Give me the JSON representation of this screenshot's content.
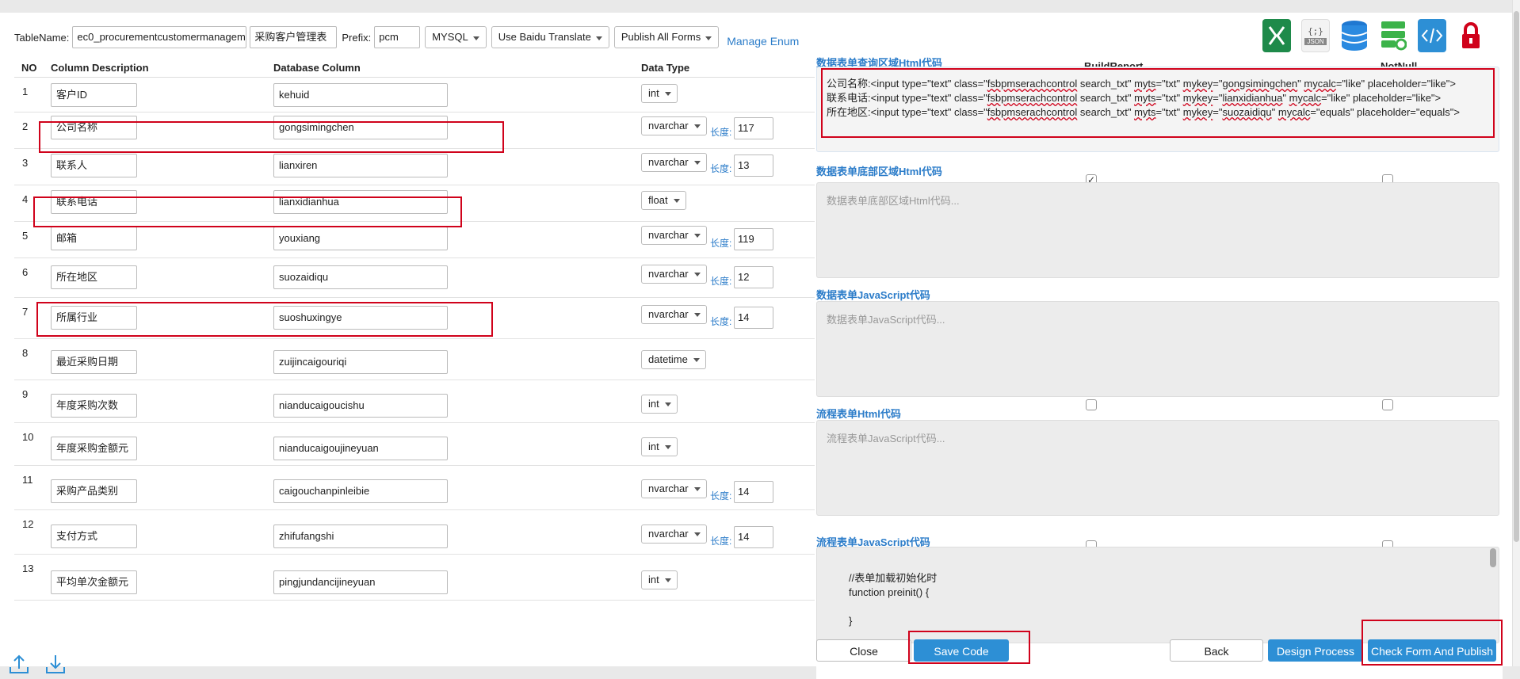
{
  "toolbar": {
    "table_name_label": "TableName:",
    "table_name_value": "ec0_procurementcustomermanagem",
    "table_cn_value": "采购客户管理表",
    "prefix_label": "Prefix:",
    "prefix_value": "pcm",
    "db_select": "MYSQL",
    "translate_select": "Use Baidu Translate",
    "publish_select": "Publish All Forms",
    "manage_enum": "Manage Enum"
  },
  "icons": [
    "excel-icon",
    "json-icon",
    "database-icon",
    "server-sync-icon",
    "code-icon",
    "lock-icon"
  ],
  "table": {
    "headers": {
      "no": "NO",
      "desc": "Column Description",
      "db": "Database Column",
      "type": "Data Type"
    },
    "length_label": "长度:",
    "rows": [
      {
        "no": "1",
        "desc": "客户ID",
        "db": "kehuid",
        "type": "int",
        "length": ""
      },
      {
        "no": "2",
        "desc": "公司名称",
        "db": "gongsimingchen",
        "type": "nvarchar",
        "length": "117"
      },
      {
        "no": "3",
        "desc": "联系人",
        "db": "lianxiren",
        "type": "nvarchar",
        "length": "13"
      },
      {
        "no": "4",
        "desc": "联系电话",
        "db": "lianxidianhua",
        "type": "float",
        "length": ""
      },
      {
        "no": "5",
        "desc": "邮箱",
        "db": "youxiang",
        "type": "nvarchar",
        "length": "119"
      },
      {
        "no": "6",
        "desc": "所在地区",
        "db": "suozaidiqu",
        "type": "nvarchar",
        "length": "12"
      },
      {
        "no": "7",
        "desc": "所属行业",
        "db": "suoshuxingye",
        "type": "nvarchar",
        "length": "14"
      },
      {
        "no": "8",
        "desc": "最近采购日期",
        "db": "zuijincaigouriqi",
        "type": "datetime",
        "length": ""
      },
      {
        "no": "9",
        "desc": "年度采购次数",
        "db": "nianducaigoucishu",
        "type": "int",
        "length": ""
      },
      {
        "no": "10",
        "desc": "年度采购金额元",
        "db": "nianducaigoujineyuan",
        "type": "int",
        "length": ""
      },
      {
        "no": "11",
        "desc": "采购产品类别",
        "db": "caigouchanpinleibie",
        "type": "nvarchar",
        "length": "14"
      },
      {
        "no": "12",
        "desc": "支付方式",
        "db": "zhifufangshi",
        "type": "nvarchar",
        "length": "14"
      },
      {
        "no": "13",
        "desc": "平均单次金额元",
        "db": "pingjundancijineyuan",
        "type": "int",
        "length": ""
      }
    ]
  },
  "panel": {
    "build_report_header": "BuildReport",
    "not_null_header": "NotNull",
    "query_title": "数据表单查询区域Html代码",
    "query_code": [
      [
        "公司名称:<input type=\"text\" class=\"",
        "fsbpmserachcontrol",
        " search_txt\" ",
        "myts",
        "=\"txt\" ",
        "mykey",
        "=\"",
        "gongsimingchen",
        "\" ",
        "mycalc",
        "=\"like\" placeholder=\"like\">"
      ],
      [
        "联系电话:<input type=\"text\" class=\"",
        "fsbpmserachcontrol",
        " search_txt\" ",
        "myts",
        "=\"txt\" ",
        "mykey",
        "=\"",
        "lianxidianhua",
        "\" ",
        "mycalc",
        "=\"like\" placeholder=\"like\">"
      ],
      [
        "所在地区:<input type=\"text\" class=\"",
        "fsbpmserachcontrol",
        " search_txt\" ",
        "myts",
        "=\"txt\" ",
        "mykey",
        "=\"",
        "suozaidiqu",
        "\" ",
        "mycalc",
        "=\"equals\" placeholder=\"equals\">"
      ]
    ],
    "bottom_title": "数据表单底部区域Html代码",
    "bottom_placeholder": "数据表单底部区域Html代码...",
    "js_title": "数据表单JavaScript代码",
    "js_placeholder": "数据表单JavaScript代码...",
    "flow_html_title": "流程表单Html代码",
    "flow_html_placeholder": "流程表单JavaScript代码...",
    "flow_js_title": "流程表单JavaScript代码",
    "flow_js_code": [
      "//表单加载初始化时",
      "function preinit() {",
      "",
      "}"
    ]
  },
  "buttons": {
    "close": "Close",
    "save_code": "Save Code",
    "back": "Back",
    "design_process": "Design Process",
    "check_publish": "Check Form And Publish"
  },
  "colors": {
    "accent": "#2d8fd5",
    "highlight": "#d0021b",
    "link": "#2b7cc9"
  }
}
